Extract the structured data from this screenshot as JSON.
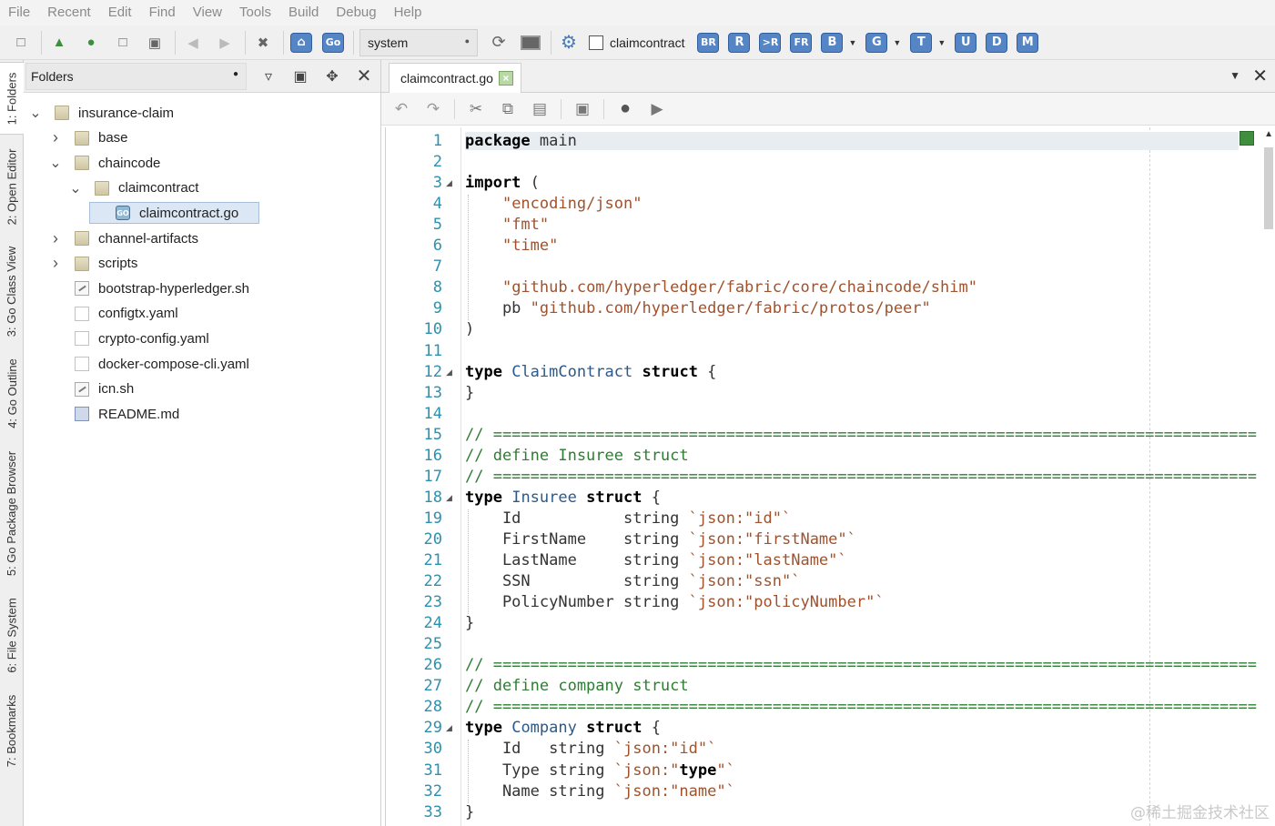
{
  "menu": [
    "File",
    "Recent",
    "Edit",
    "Find",
    "View",
    "Tools",
    "Build",
    "Debug",
    "Help"
  ],
  "toolbar": {
    "system_value": "system",
    "checkbox_label": "claimcontract",
    "letter_buttons": [
      "BR",
      "R",
      ">R",
      "FR",
      "B",
      "G",
      "T",
      "U",
      "D",
      "M"
    ],
    "go_label": "Go"
  },
  "side_tabs": [
    "1: Folders",
    "2: Open Editor",
    "3: Go Class View",
    "4: Go Outline",
    "5: Go Package Browser",
    "6: File System",
    "7: Bookmarks"
  ],
  "folders": {
    "title": "Folders",
    "tree": [
      {
        "label": "insurance-claim",
        "icon": "folder",
        "chev": "open"
      },
      {
        "label": "base",
        "icon": "folder",
        "chev": "closed"
      },
      {
        "label": "chaincode",
        "icon": "folder",
        "chev": "open"
      },
      {
        "label": "claimcontract",
        "icon": "folder",
        "chev": "open"
      },
      {
        "label": "claimcontract.go",
        "icon": "go",
        "chev": "none",
        "selected": true
      },
      {
        "label": "channel-artifacts",
        "icon": "folder",
        "chev": "closed"
      },
      {
        "label": "scripts",
        "icon": "folder",
        "chev": "closed"
      },
      {
        "label": "bootstrap-hyperledger.sh",
        "icon": "sh",
        "chev": "none"
      },
      {
        "label": "configtx.yaml",
        "icon": "file",
        "chev": "none"
      },
      {
        "label": "crypto-config.yaml",
        "icon": "file",
        "chev": "none"
      },
      {
        "label": "docker-compose-cli.yaml",
        "icon": "file",
        "chev": "none"
      },
      {
        "label": "icn.sh",
        "icon": "sh",
        "chev": "none"
      },
      {
        "label": "README.md",
        "icon": "md",
        "chev": "none"
      }
    ]
  },
  "editor": {
    "tab_label": "claimcontract.go",
    "code_lines": [
      "package main",
      "",
      "import (",
      "    \"encoding/json\"",
      "    \"fmt\"",
      "    \"time\"",
      "",
      "    \"github.com/hyperledger/fabric/core/chaincode/shim\"",
      "    pb \"github.com/hyperledger/fabric/protos/peer\"",
      ")",
      "",
      "type ClaimContract struct {",
      "}",
      "",
      "// ==================================================================================",
      "// define Insuree struct",
      "// ==================================================================================",
      "type Insuree struct {",
      "    Id           string `json:\"id\"`",
      "    FirstName    string `json:\"firstName\"`",
      "    LastName     string `json:\"lastName\"`",
      "    SSN          string `json:\"ssn\"`",
      "    PolicyNumber string `json:\"policyNumber\"`",
      "}",
      "",
      "// ==================================================================================",
      "// define company struct",
      "// ==================================================================================",
      "type Company struct {",
      "    Id   string `json:\"id\"`",
      "    Type string `json:\"type\"`",
      "    Name string `json:\"name\"`",
      "}"
    ],
    "fold_lines": [
      3,
      12,
      18,
      29
    ]
  },
  "watermark": "@稀土掘金技术社区"
}
